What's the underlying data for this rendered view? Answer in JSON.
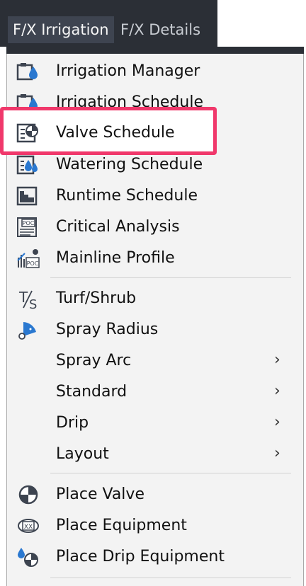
{
  "menubar": {
    "items": [
      {
        "label": "F/X Irrigation"
      },
      {
        "label": "F/X Details"
      }
    ]
  },
  "menu": {
    "items": [
      {
        "label": "Irrigation Manager",
        "icon": "irrigation-manager-icon"
      },
      {
        "label": "Irrigation Schedule",
        "icon": "irrigation-schedule-icon"
      },
      {
        "label": "Valve Schedule",
        "icon": "valve-schedule-icon"
      },
      {
        "label": "Watering Schedule",
        "icon": "watering-schedule-icon"
      },
      {
        "label": "Runtime Schedule",
        "icon": "runtime-schedule-icon"
      },
      {
        "label": "Critical Analysis",
        "icon": "critical-analysis-icon"
      },
      {
        "label": "Mainline Profile",
        "icon": "mainline-profile-icon"
      },
      {
        "label": "Turf/Shrub",
        "icon": "turf-shrub-icon"
      },
      {
        "label": "Spray Radius",
        "icon": "spray-radius-icon"
      },
      {
        "label": "Spray Arc",
        "submenu": true
      },
      {
        "label": "Standard",
        "submenu": true
      },
      {
        "label": "Drip",
        "submenu": true
      },
      {
        "label": "Layout",
        "submenu": true
      },
      {
        "label": "Place Valve",
        "icon": "place-valve-icon"
      },
      {
        "label": "Place Equipment",
        "icon": "place-equipment-icon"
      },
      {
        "label": "Place Drip Equipment",
        "icon": "place-drip-equipment-icon"
      }
    ],
    "submenu_glyph": "›",
    "icon_text": {
      "poc": "POC",
      "xx": "XX",
      "turf_t": "T",
      "turf_s": "S"
    }
  },
  "colors": {
    "menubar_bg": "#2b2f36",
    "menu_bg": "#f3f3f3",
    "highlight_border": "#f0386b",
    "icon_blue": "#2a78d0",
    "icon_dark": "#3d4450"
  }
}
